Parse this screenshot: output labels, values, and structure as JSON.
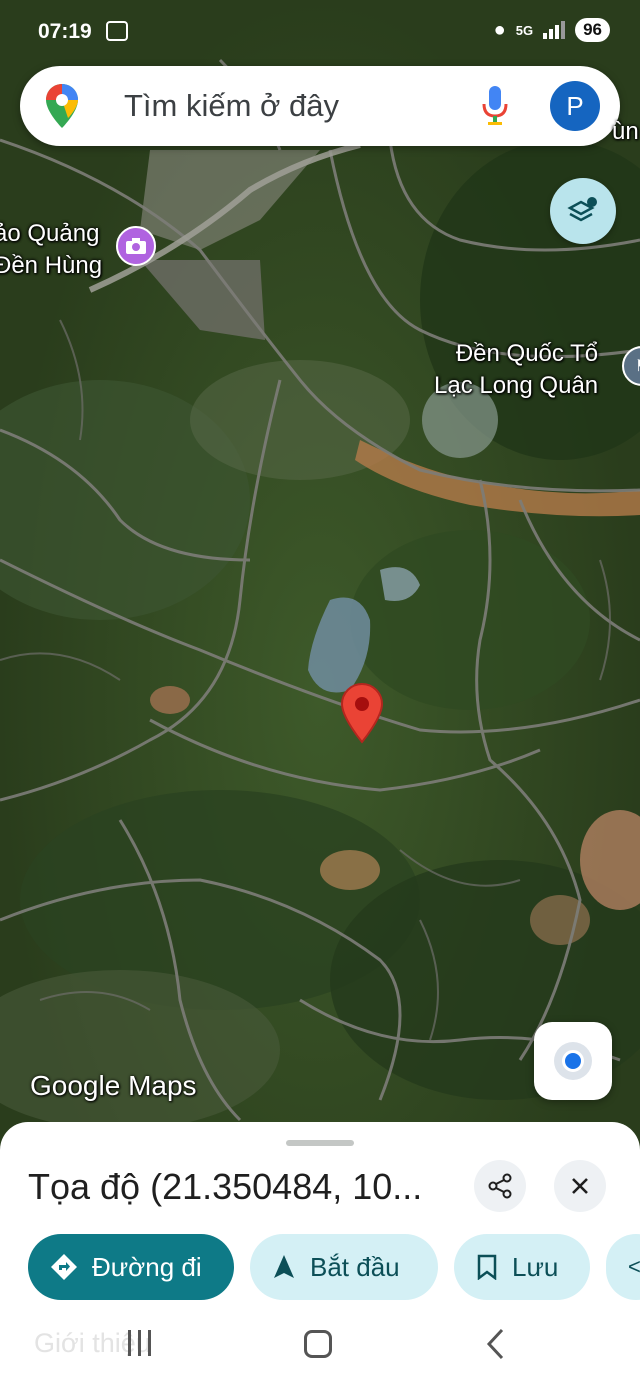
{
  "status_bar": {
    "time": "07:19",
    "network": "5G",
    "battery": "96"
  },
  "search": {
    "placeholder": "Tìm kiếm ở đây",
    "avatar_initial": "P"
  },
  "map": {
    "labels": {
      "place_a_line1": "ảo Quảng",
      "place_a_line2": "Đền Hùng",
      "place_b_line1": "Đền Quốc Tổ",
      "place_b_line2": "Lạc Long Quân",
      "corner_fragment": "ùn"
    },
    "watermark": "Google Maps"
  },
  "place_sheet": {
    "title": "Tọa độ (21.350484, 10...",
    "actions": [
      {
        "label": "Đường đi",
        "icon": "directions-icon"
      },
      {
        "label": "Bắt đầu",
        "icon": "navigation-arrow-icon"
      },
      {
        "label": "Lưu",
        "icon": "bookmark-icon"
      }
    ],
    "faded_tab": "Giới thiệu"
  },
  "colors": {
    "primary_chip": "#0e7a87",
    "secondary_chip": "#d4f0f5",
    "pin_red": "#ea4335",
    "layers_button": "#b9e4ec",
    "avatar": "#1565c0"
  }
}
